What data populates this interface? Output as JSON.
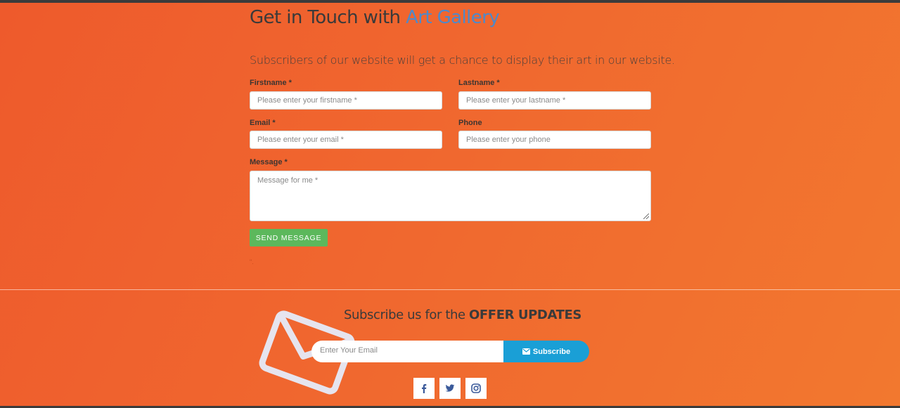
{
  "contact": {
    "heading_main": "Get in Touch with ",
    "heading_accent": "Art Gallery",
    "subtitle": "Subscribers of our website will get a chance to display their art in our website.",
    "firstname": {
      "label": "Firstname *",
      "placeholder": "Please enter your firstname *"
    },
    "lastname": {
      "label": "Lastname *",
      "placeholder": "Please enter your lastname *"
    },
    "email": {
      "label": "Email *",
      "placeholder": "Please enter your email *"
    },
    "phone": {
      "label": "Phone",
      "placeholder": "Please enter your phone"
    },
    "message": {
      "label": "Message *",
      "placeholder": "Message for me *"
    },
    "send_label": "SEND MESSAGE",
    "mark": "\"."
  },
  "subscribe": {
    "heading_prefix": "Subscribe us for the ",
    "heading_bold": "OFFER UPDATES",
    "email_placeholder": "Enter Your Email",
    "button_label": "Subscribe"
  },
  "social": [
    "facebook-icon",
    "twitter-icon",
    "instagram-icon"
  ],
  "colors": {
    "background": "#f0672f",
    "accent_blue": "#4f89c9",
    "send_button": "#5cb85c",
    "subscribe_button": "#1a9fd6",
    "social_icon": "#3b5a9a"
  }
}
